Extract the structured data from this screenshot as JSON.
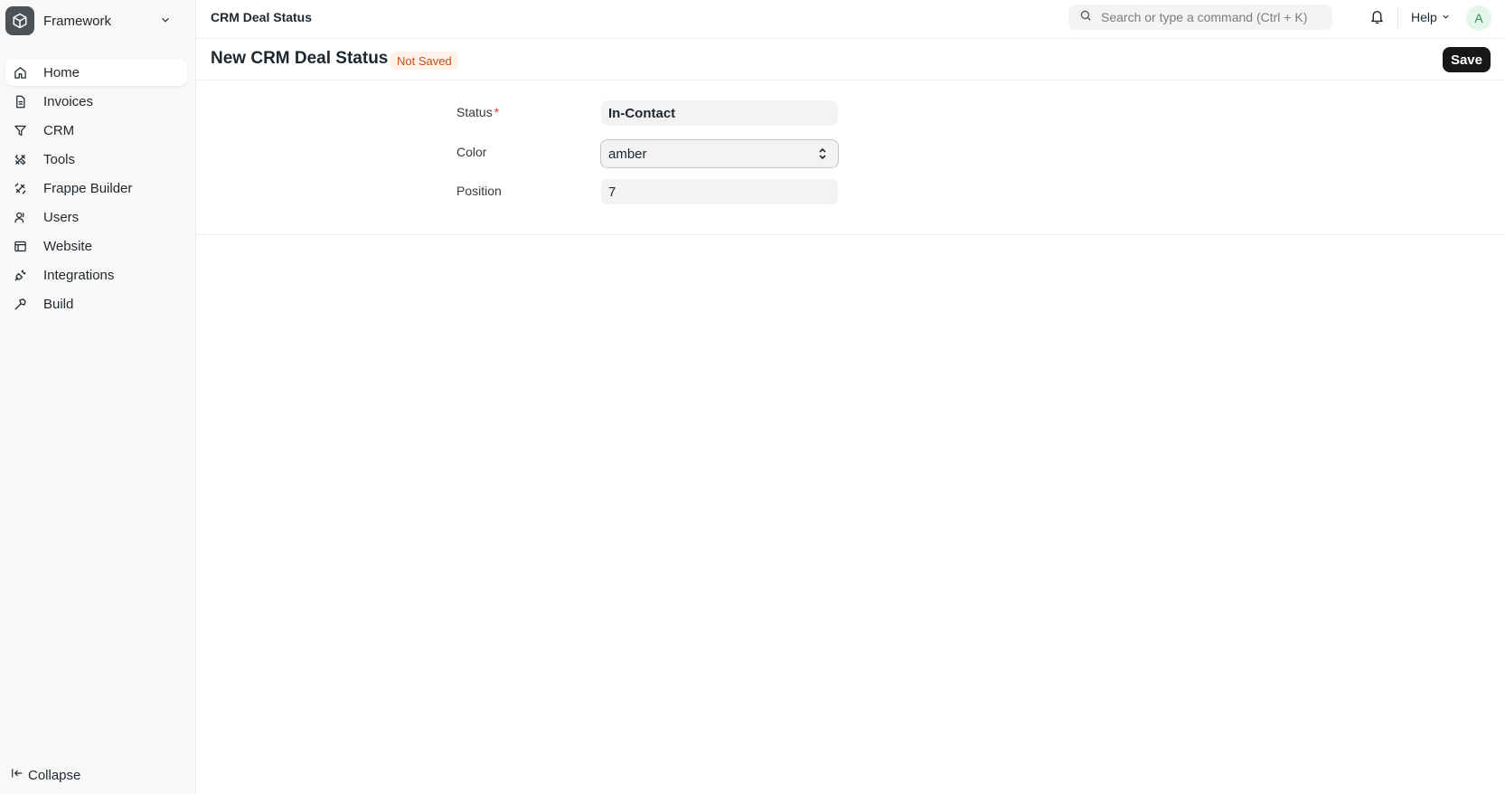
{
  "app": {
    "name": "Framework"
  },
  "sidebar": {
    "items": [
      {
        "label": "Home",
        "icon": "home-icon"
      },
      {
        "label": "Invoices",
        "icon": "file-icon"
      },
      {
        "label": "CRM",
        "icon": "filter-icon"
      },
      {
        "label": "Tools",
        "icon": "tools-icon"
      },
      {
        "label": "Frappe Builder",
        "icon": "builder-icon"
      },
      {
        "label": "Users",
        "icon": "user-icon"
      },
      {
        "label": "Website",
        "icon": "browser-icon"
      },
      {
        "label": "Integrations",
        "icon": "plug-icon"
      },
      {
        "label": "Build",
        "icon": "hammer-icon"
      }
    ],
    "collapse_label": "Collapse"
  },
  "topbar": {
    "breadcrumb": "CRM Deal Status",
    "search_placeholder": "Search or type a command (Ctrl + K)",
    "help_label": "Help",
    "avatar_initial": "A"
  },
  "page": {
    "title": "New CRM Deal Status",
    "badge": "Not Saved",
    "save_label": "Save"
  },
  "form": {
    "status": {
      "label": "Status",
      "required_mark": "*",
      "value": "In-Contact"
    },
    "color": {
      "label": "Color",
      "value": "amber"
    },
    "position": {
      "label": "Position",
      "value": "7"
    }
  },
  "colors": {
    "primary_button": "#171717",
    "badge_bg": "#fff0e8",
    "badge_text": "#c4501c",
    "required": "#e03636"
  }
}
